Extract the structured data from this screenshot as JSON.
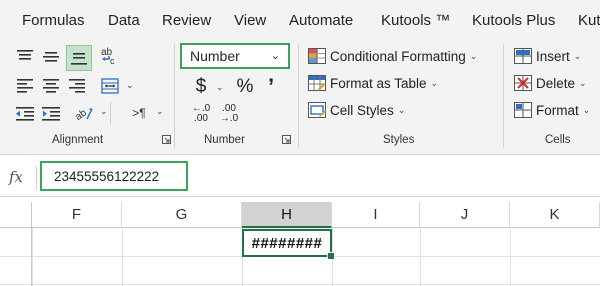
{
  "menu": {
    "tabs": [
      "Formulas",
      "Data",
      "Review",
      "View",
      "Automate",
      "Kutools ™",
      "Kutools Plus",
      "Kut"
    ]
  },
  "ribbon": {
    "alignment": {
      "label": "Alignment",
      "paragraph_glyph": "¶"
    },
    "number": {
      "label": "Number",
      "format_value": "Number",
      "currency_symbol": "$",
      "percent_symbol": "%",
      "comma_symbol": "’",
      "increase_decimal_top": "←.0",
      "increase_decimal_bottom": ".00",
      "decrease_decimal_top": ".00",
      "decrease_decimal_bottom": "→.0"
    },
    "styles": {
      "label": "Styles",
      "conditional_formatting": "Conditional Formatting",
      "format_as_table": "Format as Table",
      "cell_styles": "Cell Styles"
    },
    "cells": {
      "label": "Cells",
      "insert": "Insert",
      "delete": "Delete",
      "format": "Format"
    }
  },
  "formula_bar": {
    "fx_label": "fx",
    "value": "23455556122222"
  },
  "grid": {
    "columns": [
      "F",
      "G",
      "H",
      "I",
      "J",
      "K"
    ],
    "selected_column": "H",
    "selected_cell_display": "########"
  },
  "colors": {
    "highlight_green": "#3aa55a",
    "excel_green": "#217346",
    "ribbon_bg": "#f3f3f3"
  }
}
